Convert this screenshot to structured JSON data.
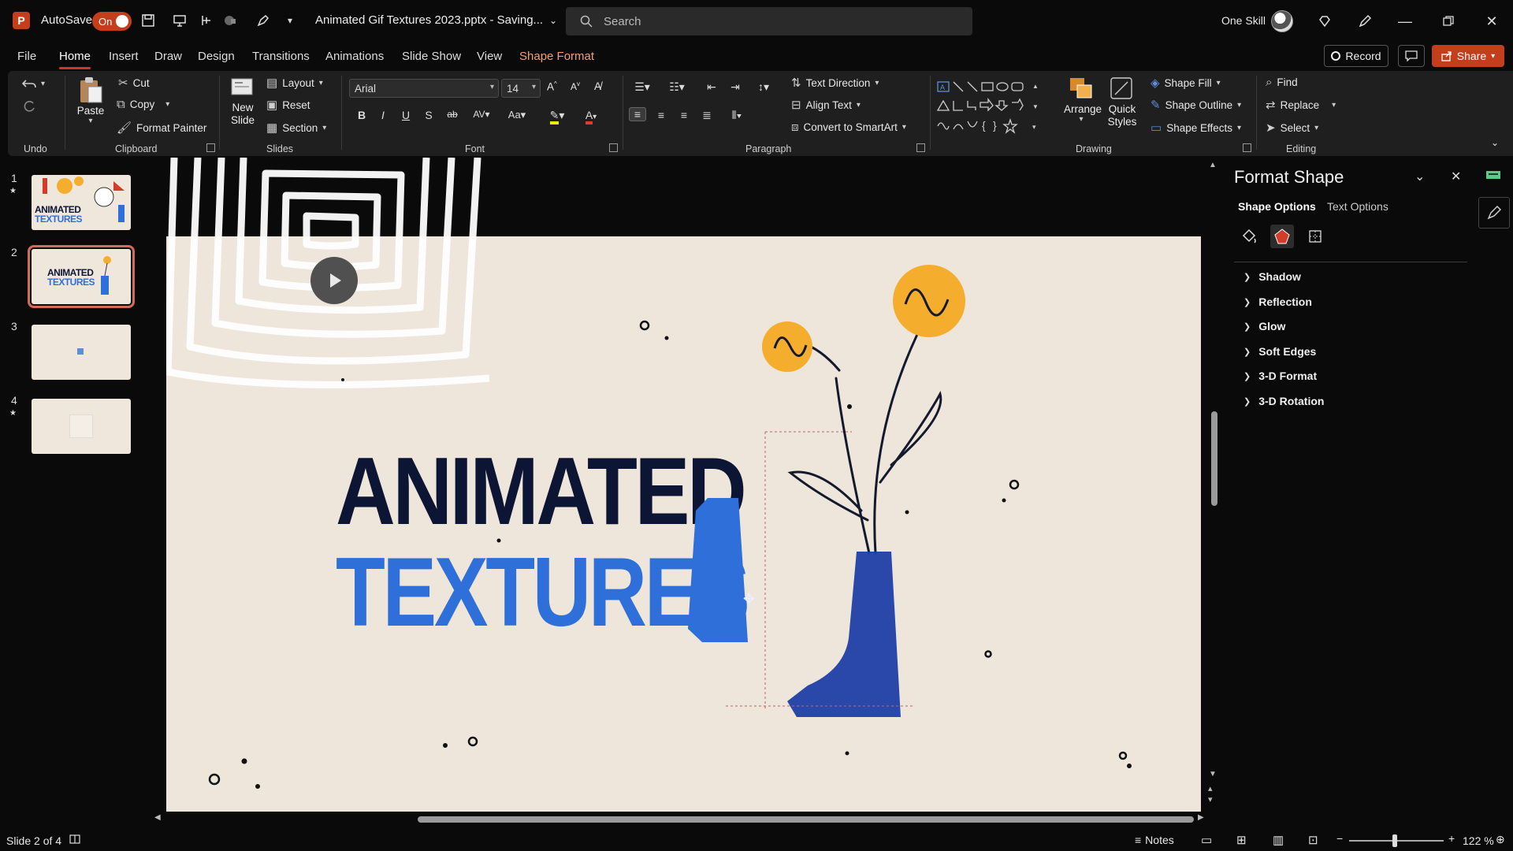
{
  "titlebar": {
    "app_icon": "P",
    "autosave_label": "AutoSave",
    "autosave_state": "On",
    "doc_title": "Animated Gif Textures 2023.pptx - Saving...",
    "search_placeholder": "Search",
    "user_name": "One Skill"
  },
  "menu": {
    "tabs": [
      "File",
      "Home",
      "Insert",
      "Draw",
      "Design",
      "Transitions",
      "Animations",
      "Slide Show",
      "View",
      "Shape Format"
    ],
    "active_tab": "Home",
    "record_label": "Record",
    "share_label": "Share"
  },
  "ribbon": {
    "undo_label": "Undo",
    "clipboard": {
      "paste": "Paste",
      "cut": "Cut",
      "copy": "Copy",
      "format_painter": "Format Painter",
      "label": "Clipboard"
    },
    "slides": {
      "new_slide_1": "New",
      "new_slide_2": "Slide",
      "layout": "Layout",
      "reset": "Reset",
      "section": "Section",
      "label": "Slides"
    },
    "font": {
      "family": "Arial",
      "size": "14",
      "label": "Font"
    },
    "paragraph": {
      "text_direction": "Text Direction",
      "align_text": "Align Text",
      "convert_smartart": "Convert to SmartArt",
      "label": "Paragraph"
    },
    "drawing": {
      "arrange": "Arrange",
      "quick_styles_1": "Quick",
      "quick_styles_2": "Styles",
      "shape_fill": "Shape Fill",
      "shape_outline": "Shape Outline",
      "shape_effects": "Shape Effects",
      "label": "Drawing"
    },
    "editing": {
      "find": "Find",
      "replace": "Replace",
      "select": "Select",
      "label": "Editing"
    }
  },
  "thumbnails": [
    {
      "num": "1",
      "starred": true,
      "title_1": "ANIMATED",
      "title_2": "TEXTURES"
    },
    {
      "num": "2",
      "starred": false,
      "selected": true,
      "title_1": "ANIMATED",
      "title_2": "TEXTURES"
    },
    {
      "num": "3",
      "starred": false
    },
    {
      "num": "4",
      "starred": true
    }
  ],
  "slide": {
    "title_line_1": "ANIMATED",
    "title_line_2": "TEXTURES",
    "colors": {
      "background": "#eee6db",
      "navy": "#0c1634",
      "blue": "#2e6fd9",
      "yellow": "#f5ad2e"
    }
  },
  "format_pane": {
    "title": "Format Shape",
    "tabs": [
      "Shape Options",
      "Text Options"
    ],
    "sections": [
      "Shadow",
      "Reflection",
      "Glow",
      "Soft Edges",
      "3-D Format",
      "3-D Rotation"
    ]
  },
  "statusbar": {
    "slide_info": "Slide 2 of 4",
    "notes_label": "Notes",
    "zoom": "122 %",
    "zoom_level_pct": 122
  }
}
